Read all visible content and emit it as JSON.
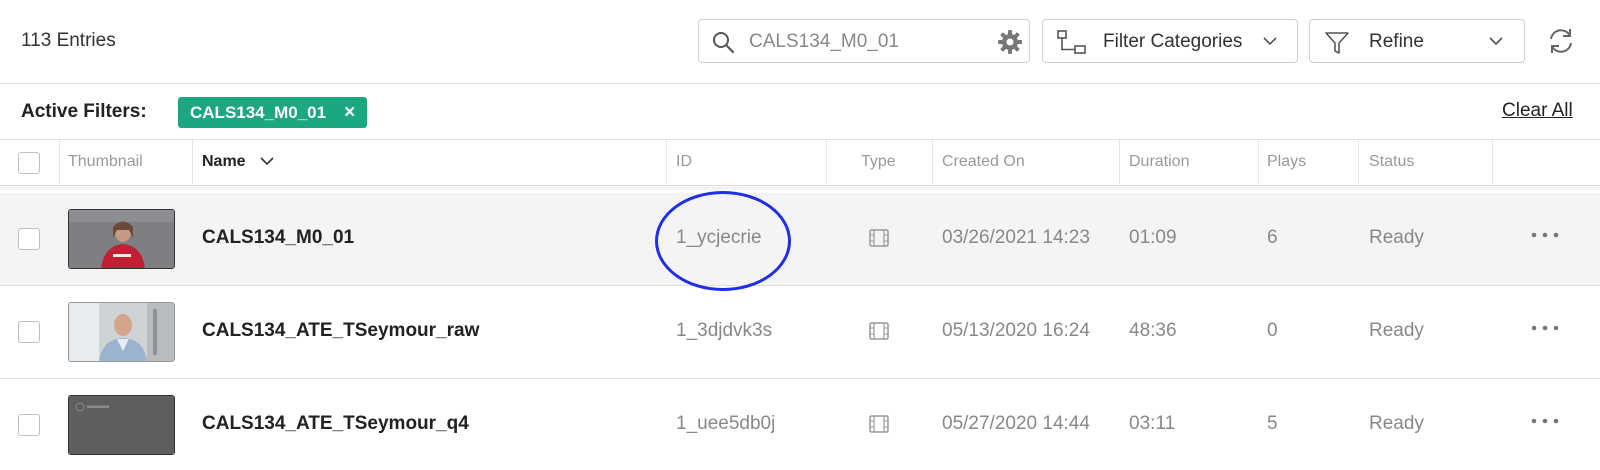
{
  "header": {
    "entries_count": "113 Entries",
    "search": {
      "value": "CALS134_M0_01",
      "placeholder": ""
    },
    "filter_categories_label": "Filter Categories",
    "refine_label": "Refine"
  },
  "filters": {
    "label": "Active Filters:",
    "chips": [
      {
        "label": "CALS134_M0_01",
        "remove": "×"
      }
    ],
    "clear_all": "Clear All"
  },
  "table": {
    "columns": [
      "Thumbnail",
      "Name",
      "ID",
      "Type",
      "Created On",
      "Duration",
      "Plays",
      "Status"
    ],
    "rows": [
      {
        "name": "CALS134_M0_01",
        "id": "1_ycjecrie",
        "type_icon": "video-icon",
        "created": "03/26/2021 14:23",
        "duration": "01:09",
        "plays": "6",
        "status": "Ready"
      },
      {
        "name": "CALS134_ATE_TSeymour_raw",
        "id": "1_3djdvk3s",
        "type_icon": "video-icon",
        "created": "05/13/2020 16:24",
        "duration": "48:36",
        "plays": "0",
        "status": "Ready"
      },
      {
        "name": "CALS134_ATE_TSeymour_q4",
        "id": "1_uee5db0j",
        "type_icon": "video-icon",
        "created": "05/27/2020 14:44",
        "duration": "03:11",
        "plays": "5",
        "status": "Ready"
      }
    ]
  },
  "colors": {
    "chip": "#1aa782",
    "annotation": "#1f2ee8",
    "selected_row": "#f4f4f4"
  }
}
